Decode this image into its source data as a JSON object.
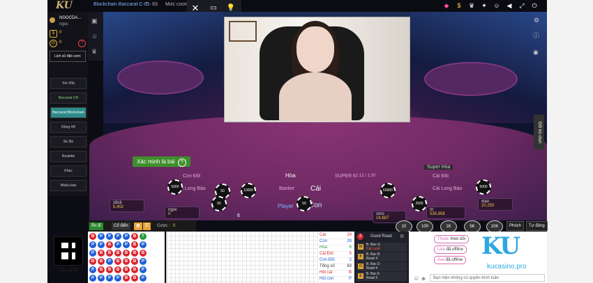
{
  "header": {
    "logo": "KU",
    "game_title": "Blockchain Baccarat C-01",
    "round": "7 - 63",
    "limit_label": "Mức cược"
  },
  "modal_controls": [
    "close",
    "picture-in-picture",
    "light"
  ],
  "sidebar": {
    "username": "NGOCDA...",
    "nickname": "ngoc",
    "balance": "0",
    "history_label": "Lịch sử đặt cược",
    "menu": [
      {
        "label": "Xóc Đĩa",
        "active": false
      },
      {
        "label": "Baccarat CN",
        "active": false
      },
      {
        "label": "Baccarat Blockchain",
        "active": true
      },
      {
        "label": "Rồng Hổ",
        "active": false
      },
      {
        "label": "Sic Bo",
        "active": false
      },
      {
        "label": "Roulette",
        "active": false
      },
      {
        "label": "Khác",
        "active": false
      },
      {
        "label": "Nhiều bàn",
        "active": false
      }
    ]
  },
  "verify_label": "Xác minh là bài",
  "right_tab": "Đổi trò chơi",
  "table": {
    "labels": {
      "player_pair": "Con Đôi",
      "hoa": "Hòa",
      "super6": "SUPER 6",
      "super6_odds": "1:12 / 1:20",
      "banker_pair": "Cái Đôi",
      "player_dragon": "Con Long Bảo",
      "banker": "Banker",
      "cai": "Cái",
      "banker_dragon": "Cái Long Bảo",
      "player": "Player",
      "con": "Con",
      "super_hoa": "Super Hòa"
    },
    "chips_on_table": [
      "5000",
      "50",
      "10000",
      "60000",
      "5000",
      "50",
      "50",
      "2500"
    ],
    "players": [
      {
        "name": "z8cẻ",
        "amount": "5,402"
      },
      {
        "name": "ngoc",
        "amount": "0"
      },
      {
        "name": "zero",
        "amount": "16,687"
      },
      {
        "name": "nt",
        "amount": "535,958"
      },
      {
        "name": "xiao",
        "amount": "20,250"
      }
    ],
    "seat_number": "6",
    "seat_number_2": "7"
  },
  "chips_bar": [
    "10",
    "100",
    "1K",
    "5K",
    "10K"
  ],
  "action_buttons": [
    "Phóch",
    "Tự động"
  ],
  "bottom_tabs": {
    "hidden": "Ẩn đi",
    "stats": "Cổ điển",
    "bet_label": "Cược :",
    "bet_value": "0"
  },
  "road_grid": [
    [
      "B",
      "P",
      "P",
      "P",
      "P",
      "B",
      "T"
    ],
    [
      "P",
      "P",
      "B",
      "P",
      "P",
      "B",
      "P"
    ],
    [
      "P",
      "B",
      "B",
      "B",
      "B",
      "B",
      "B"
    ],
    [
      "B",
      "B",
      "P",
      "B",
      "B",
      "B",
      "P"
    ],
    [
      "P",
      "B",
      "B",
      "B",
      "B",
      "B",
      "P"
    ],
    [
      "P",
      "P",
      "P",
      "P",
      "B",
      "B",
      "P"
    ]
  ],
  "stats": [
    {
      "label": "Cái",
      "value": "29"
    },
    {
      "label": "Con",
      "value": "28"
    },
    {
      "label": "Hòa",
      "value": "6"
    },
    {
      "label": "Cái Đôi",
      "value": "5"
    },
    {
      "label": "Con Đôi",
      "value": "2"
    },
    {
      "label": "Tổng số",
      "value": "63"
    },
    {
      "label": "Hội cái",
      "value": "B"
    },
    {
      "label": "Hội con",
      "value": "P"
    }
  ],
  "good_road": {
    "title": "Good Road",
    "count": "3",
    "rows": [
      {
        "table": "B. Bac G",
        "sub": "Cái Lượt"
      },
      {
        "table": "B. Bac B",
        "sub": "Road 4"
      },
      {
        "table": "B. Bac D",
        "sub": "Road 4"
      },
      {
        "table": "B. Bac E",
        "sub": "Road 3"
      }
    ]
  },
  "chat": {
    "messages": [
      {
        "user": "Thuần",
        "text": "theo dõi"
      },
      {
        "user": "Lisa",
        "text": "đã offline"
      },
      {
        "user": "Ava",
        "text": "đã offline"
      }
    ],
    "input_placeholder": "Bạn hiện không có quyền bình luận"
  },
  "watermark": {
    "brand": "KU",
    "site": "kucasino.pro"
  },
  "app_label": "Tải APP",
  "colors": {
    "banker": "#d9262e",
    "player": "#1e5fd6",
    "tie": "#2a9a3b",
    "accent": "#2d8a89",
    "table": "#6e2a63"
  }
}
